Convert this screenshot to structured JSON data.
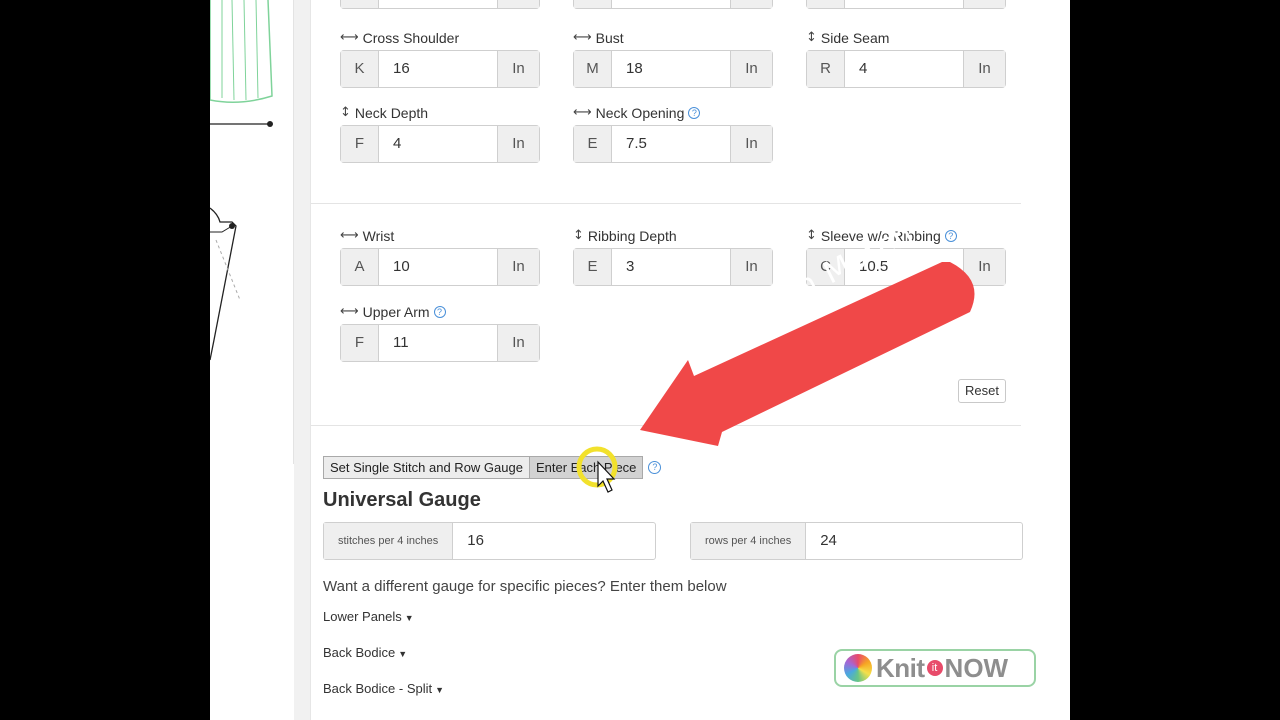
{
  "measurements_top": [
    {
      "name": "cross-shoulder",
      "label": "Cross Shoulder",
      "dim": "horizontal",
      "prefix": "K",
      "value": "16",
      "unit": "In"
    },
    {
      "name": "bust",
      "label": "Bust",
      "dim": "horizontal",
      "prefix": "M",
      "value": "18",
      "unit": "In"
    },
    {
      "name": "side-seam",
      "label": "Side Seam",
      "dim": "vertical",
      "prefix": "R",
      "value": "4",
      "unit": "In"
    },
    {
      "name": "neck-depth",
      "label": "Neck Depth",
      "dim": "vertical",
      "prefix": "F",
      "value": "4",
      "unit": "In"
    },
    {
      "name": "neck-opening",
      "label": "Neck Opening",
      "dim": "horizontal",
      "prefix": "E",
      "value": "7.5",
      "unit": "In"
    }
  ],
  "measurements_sleeve": [
    {
      "name": "wrist",
      "label": "Wrist",
      "dim": "horizontal",
      "prefix": "A",
      "value": "10",
      "unit": "In"
    },
    {
      "name": "ribbing-depth",
      "label": "Ribbing Depth",
      "dim": "vertical",
      "prefix": "E",
      "value": "3",
      "unit": "In"
    },
    {
      "name": "sleeve-wo-ribbing",
      "label": "Sleeve w/o Ribbing",
      "dim": "vertical",
      "prefix": "C",
      "value": "10.5",
      "unit": "In"
    },
    {
      "name": "upper-arm",
      "label": "Upper Arm",
      "dim": "horizontal",
      "prefix": "F",
      "value": "11",
      "unit": "In"
    }
  ],
  "reset_label": "Reset",
  "gauge_tabs": {
    "single": "Set Single Stitch and Row Gauge",
    "each": "Enter Each Piece"
  },
  "gauge_title": "Universal Gauge",
  "stitches": {
    "label": "stitches per 4 inches",
    "value": "16"
  },
  "rows": {
    "label": "rows per 4 inches",
    "value": "24"
  },
  "diff_text": "Want a different gauge for specific pieces? Enter them below",
  "pieces": [
    "Lower Panels",
    "Back Bodice",
    "Back Bodice - Split"
  ],
  "overlay": {
    "arrow_text": "Mix 'n Match",
    "arrow_color": "#f04848"
  },
  "logo": {
    "part1": "Knit",
    "part2": "it",
    "part3": "NOW"
  },
  "colors": {
    "accent_green": "#7fd39a",
    "help_blue": "#4a90d9"
  }
}
